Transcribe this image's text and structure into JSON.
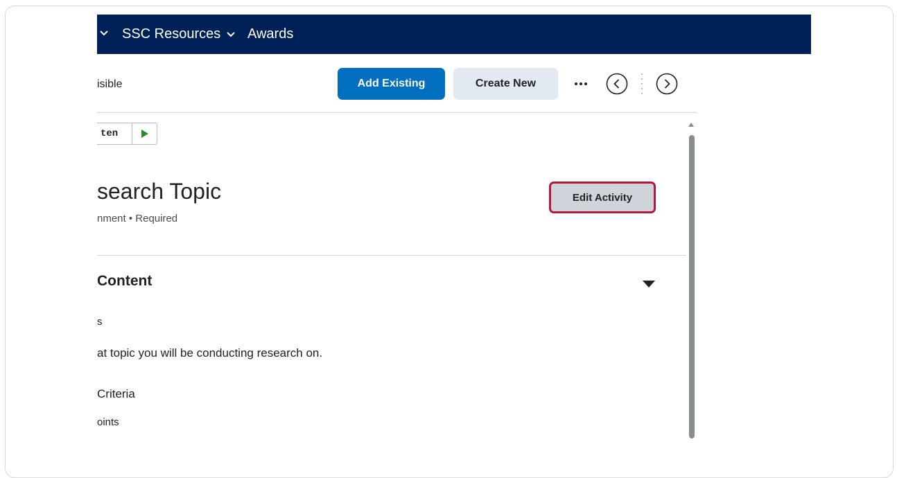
{
  "nav": {
    "items": [
      {
        "label": "SSC Resources"
      },
      {
        "label": "Awards"
      }
    ]
  },
  "toolbar": {
    "visibility_text": "isible",
    "add_existing_label": "Add Existing",
    "create_new_label": "Create New",
    "more_label": "•••"
  },
  "activity": {
    "status_text": "ten",
    "title": "search Topic",
    "meta": "nment  •  Required",
    "edit_label": "Edit Activity"
  },
  "content": {
    "heading": "Content",
    "subheading": "s",
    "description": "at topic you will be conducting research on.",
    "criteria_label": "Criteria",
    "points_label": "oints"
  },
  "colors": {
    "navbar": "#002058",
    "primary_button": "#006fbf",
    "secondary_button": "#e3e9f1",
    "focus_ring": "#b5163c",
    "play_icon": "#2e8a2e"
  }
}
